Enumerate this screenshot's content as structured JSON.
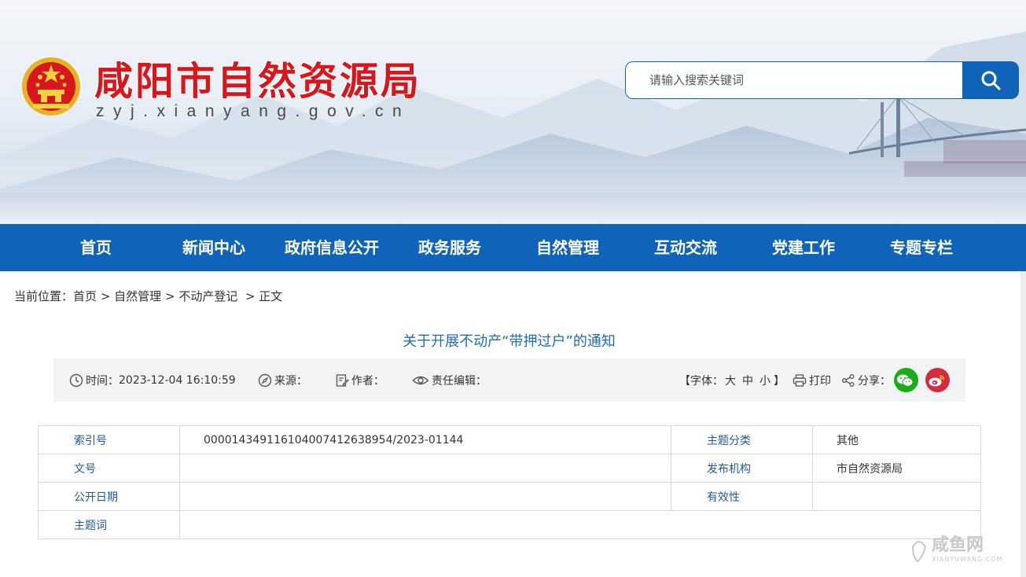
{
  "header": {
    "site_title": "咸阳市自然资源局",
    "site_domain": "zyj.xianyang.gov.cn",
    "search_placeholder": "请输入搜索关键词"
  },
  "nav": {
    "items": [
      "首页",
      "新闻中心",
      "政府信息公开",
      "政务服务",
      "自然管理",
      "互动交流",
      "党建工作",
      "专题专栏"
    ]
  },
  "breadcrumb": {
    "prefix": "当前位置：",
    "items": [
      "首页",
      "自然管理",
      "不动产登记",
      "正文"
    ],
    "separator": ">"
  },
  "article": {
    "title": "关于开展不动产“带押过户”的通知"
  },
  "meta": {
    "time_label": "时间：",
    "time_value": "2023-12-04 16:10:59",
    "source_label": "来源：",
    "author_label": "作者：",
    "editor_label": "责任编辑：",
    "font_open": "【字体：",
    "font_large": "大",
    "font_medium": "中",
    "font_small": "小",
    "font_close": "】",
    "print_label": "打印",
    "share_label": "分享："
  },
  "info_table": {
    "rows": [
      {
        "label": "索引号",
        "value": "000014349116104007412638954/2023-01144",
        "label2": "主题分类",
        "value2": "其他"
      },
      {
        "label": "文号",
        "value": "",
        "label2": "发布机构",
        "value2": "市自然资源局"
      },
      {
        "label": "公开日期",
        "value": "",
        "label2": "有效性",
        "value2": ""
      },
      {
        "label": "主题词",
        "value": ""
      }
    ]
  },
  "watermark": {
    "text": "咸鱼网",
    "domain": "XIANYUWANG.COM"
  },
  "colors": {
    "brand_blue": "#0f63b8",
    "title_red": "#d7171c",
    "link_blue": "#1f6bb8",
    "wechat_green": "#1aad19",
    "weibo_red": "#d52b3f"
  }
}
